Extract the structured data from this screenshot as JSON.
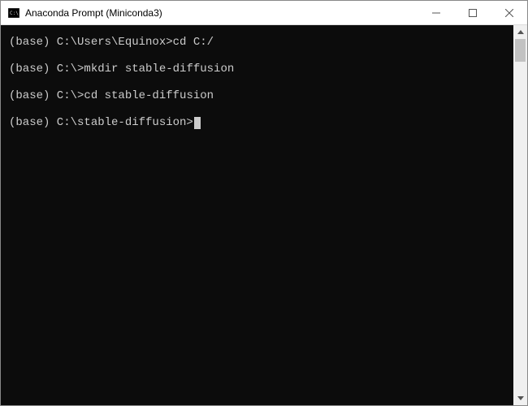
{
  "window": {
    "title": "Anaconda Prompt (Miniconda3)"
  },
  "terminal": {
    "lines": [
      {
        "prompt": "(base) C:\\Users\\Equinox>",
        "cmd": "cd C:/"
      },
      {
        "prompt": "(base) C:\\>",
        "cmd": "mkdir stable-diffusion"
      },
      {
        "prompt": "(base) C:\\>",
        "cmd": "cd stable-diffusion"
      },
      {
        "prompt": "(base) C:\\stable-diffusion>",
        "cmd": ""
      }
    ]
  }
}
